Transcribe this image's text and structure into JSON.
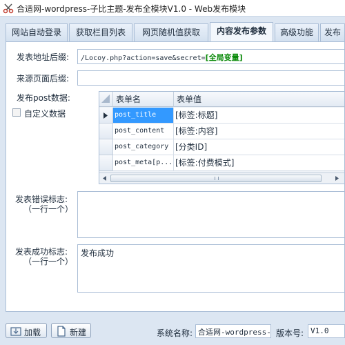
{
  "window": {
    "title": "合适网-wordpress-子比主题-发布全模块V1.0 - Web发布模块",
    "icon": "scissors-icon"
  },
  "tabs": [
    {
      "label": "网站自动登录",
      "active": false
    },
    {
      "label": "获取栏目列表",
      "active": false
    },
    {
      "label": "网页随机值获取",
      "active": false
    },
    {
      "label": "内容发布参数",
      "active": true
    },
    {
      "label": "高级功能",
      "active": false
    },
    {
      "label": "发布",
      "active": false
    }
  ],
  "form": {
    "post_url_label": "发表地址后缀:",
    "post_url_value": "/Locoy.php?action=save&secret=",
    "post_url_tag": "[全局变量]",
    "source_page_label": "来源页面后缀:",
    "source_page_value": "",
    "post_data_label": "发布post数据:",
    "custom_data_label": "自定义数据",
    "custom_data_checked": false,
    "error_label": "发表错误标志:",
    "error_sublabel": "（一行一个）",
    "error_value": "",
    "success_label": "发表成功标志:",
    "success_sublabel": "（一行一个）",
    "success_value": "发布成功"
  },
  "grid": {
    "headers": [
      "表单名",
      "表单值"
    ],
    "rows": [
      {
        "name": "post_title",
        "value": "[标签:标题]"
      },
      {
        "name": "post_content",
        "value": "[标签:内容]"
      },
      {
        "name": "post_category",
        "value": "[分类ID]"
      },
      {
        "name": "post_meta[p...",
        "value": "[标签:付费模式]"
      }
    ],
    "selected_row": 0
  },
  "footer": {
    "load_button": "加载",
    "new_button": "新建",
    "system_name_label": "系统名称:",
    "system_name_value": "合适网-wordpress-子",
    "version_label": "版本号:",
    "version_value": "V1.0"
  },
  "colors": {
    "accent": "#3399ff",
    "tag_green": "#0a8a0a",
    "background": "#dce6f2"
  }
}
